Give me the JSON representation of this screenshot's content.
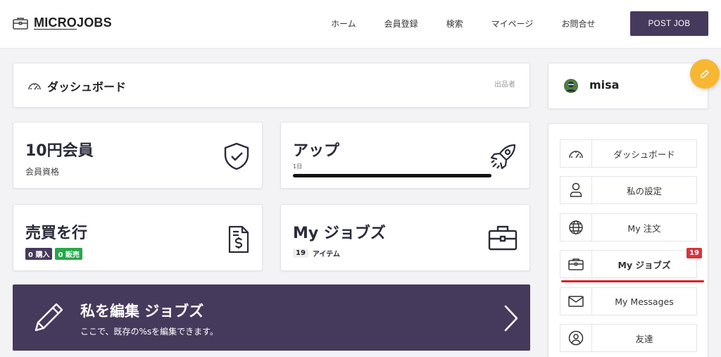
{
  "brand": {
    "name_u": "MICRO",
    "name_rest": "JOBS"
  },
  "nav": {
    "items": [
      "ホーム",
      "会員登録",
      "検索",
      "マイページ",
      "お問合せ"
    ],
    "post_job": "POST JOB"
  },
  "dashboard": {
    "title": "ダッシュボード",
    "role": "出品者"
  },
  "stats": {
    "membership": {
      "title": "10円会員",
      "sub": "会員資格"
    },
    "up": {
      "title": "アップ",
      "day_label": "1日",
      "progress": 1.0
    },
    "trade": {
      "title": "売買を行",
      "buy": "0 購入",
      "sell": "0 販売"
    },
    "myjobs": {
      "title": "My ジョブズ",
      "count": "19",
      "unit": "アイテム"
    }
  },
  "banner": {
    "title": "私を編集 ジョブズ",
    "subtitle": "ここで、既存の%sを編集できます。"
  },
  "user": {
    "name": "misa"
  },
  "sidebar": {
    "items": [
      {
        "label": "ダッシュボード",
        "icon": "speedometer-icon"
      },
      {
        "label": "私の設定",
        "icon": "user-icon"
      },
      {
        "label": "My 注文",
        "icon": "globe-icon"
      },
      {
        "label": "My ジョブズ",
        "icon": "briefcase-icon",
        "badge": "19"
      },
      {
        "label": "My Messages",
        "icon": "envelope-icon"
      },
      {
        "label": "友達",
        "icon": "user-circle-icon"
      }
    ]
  },
  "colors": {
    "primary": "#463a5c",
    "accent": "#f7b733",
    "badge_red": "#d9333a",
    "badge_green": "#26a84a"
  }
}
